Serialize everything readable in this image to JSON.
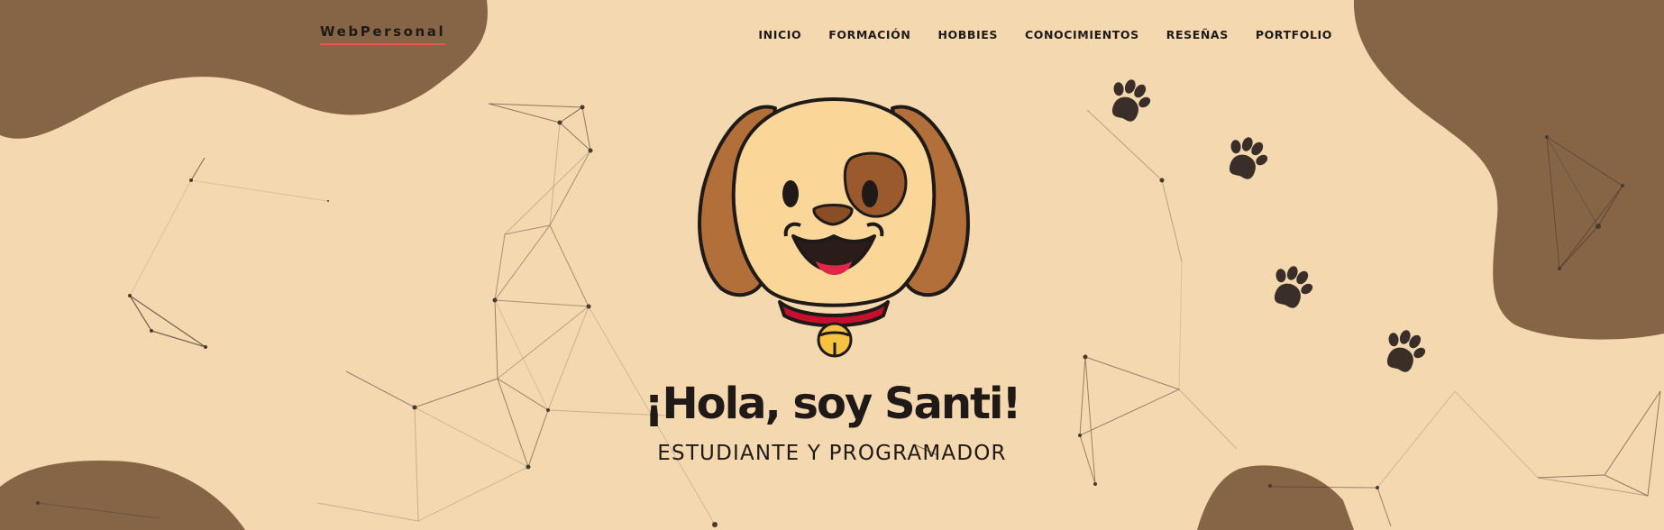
{
  "header": {
    "brand": "WebPersonal",
    "nav": [
      {
        "label": "INICIO"
      },
      {
        "label": "FORMACIÓN"
      },
      {
        "label": "HOBBIES"
      },
      {
        "label": "CONOCIMIENTOS"
      },
      {
        "label": "RESEÑAS"
      },
      {
        "label": "PORTFOLIO"
      }
    ]
  },
  "hero": {
    "greeting": "¡Hola, soy ",
    "name": "Santi!",
    "subtitle": "ESTUDIANTE Y PROGRAMADOR"
  },
  "colors": {
    "background": "#f4d8b0",
    "blob": "#866446",
    "paw": "#3a2f28",
    "accent_underline": "#e0584f",
    "text": "#1f1a17"
  },
  "icons": [
    "dog-mascot-icon",
    "paw-print-icon"
  ]
}
